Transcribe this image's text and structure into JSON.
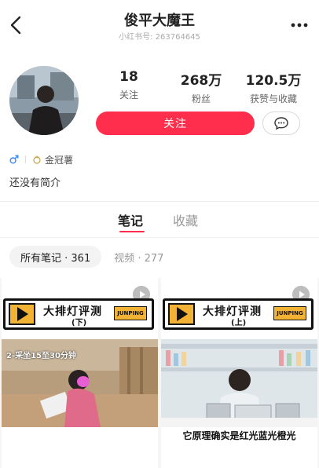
{
  "header": {
    "title": "俊平大魔王",
    "account_id": "小红书号: 263764645"
  },
  "profile": {
    "stats": [
      {
        "value": "18",
        "label": "关注"
      },
      {
        "value": "268万",
        "label": "粉丝"
      },
      {
        "value": "120.5万",
        "label": "获赞与收藏"
      }
    ],
    "follow_label": "关注",
    "badge_label": "金冠薯",
    "bio": "还没有简介"
  },
  "tabs": [
    {
      "label": "笔记",
      "active": true
    },
    {
      "label": "收藏",
      "active": false
    }
  ],
  "filters": {
    "all": "所有笔记 · 361",
    "video": "视频 · 277"
  },
  "notes": [
    {
      "banner_title": "大排灯评测",
      "banner_sub": "(下)",
      "brand": "JUNPING",
      "caption": "2-采坐15至30分钟"
    },
    {
      "banner_title": "大排灯评测",
      "banner_sub": "(上)",
      "brand": "JUNPING",
      "caption": "它原理确实是红光蓝光橙光"
    }
  ],
  "colors": {
    "accent": "#ff2e4d",
    "banner_yellow": "#f2b233"
  },
  "icons": [
    "back-icon",
    "more-icon",
    "message-icon",
    "male-icon",
    "crown-icon",
    "play-icon"
  ]
}
